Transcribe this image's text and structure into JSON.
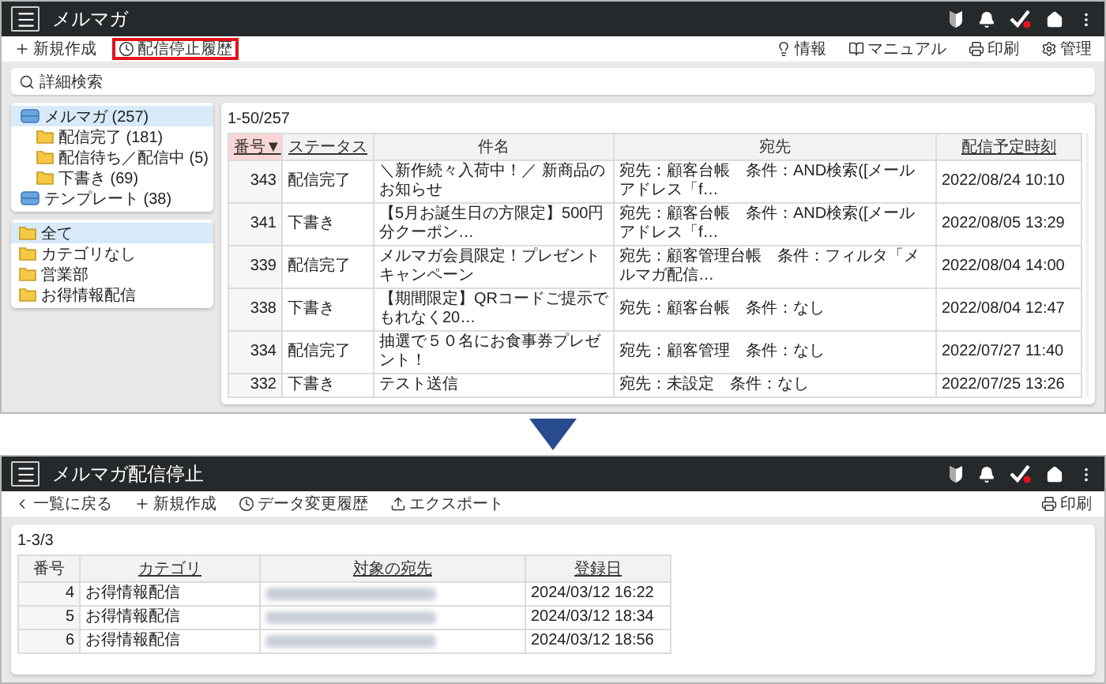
{
  "top_screen": {
    "title": "メルマガ",
    "toolbar_left": [
      {
        "label": "新規作成",
        "highlighted": false
      },
      {
        "label": "配信停止履歴",
        "highlighted": true
      }
    ],
    "toolbar_right": [
      "情報",
      "マニュアル",
      "印刷",
      "管理"
    ],
    "search": {
      "label": "詳細検索"
    },
    "tree": [
      {
        "label": "メルマガ (257)",
        "kind": "tray",
        "selected": true,
        "children": [
          {
            "label": "配信完了 (181)",
            "kind": "folder",
            "selected": false
          },
          {
            "label": "配信待ち／配信中 (5)",
            "kind": "folder",
            "selected": false
          },
          {
            "label": "下書き (69)",
            "kind": "folder",
            "selected": false
          }
        ]
      },
      {
        "label": "テンプレート (38)",
        "kind": "tray",
        "selected": false
      }
    ],
    "categories": [
      {
        "label": "全て",
        "selected": true
      },
      {
        "label": "カテゴリなし",
        "selected": false
      },
      {
        "label": "営業部",
        "selected": false
      },
      {
        "label": "お得情報配信",
        "selected": false
      }
    ],
    "count": "1-50/257",
    "table": {
      "columns": [
        {
          "label": "番号▼",
          "sortable": true,
          "sorted": true
        },
        {
          "label": "ステータス",
          "sortable": true,
          "sorted": false
        },
        {
          "label": "件名",
          "sortable": false,
          "sorted": false
        },
        {
          "label": "宛先",
          "sortable": false,
          "sorted": false
        },
        {
          "label": "配信予定時刻",
          "sortable": true,
          "sorted": false
        }
      ],
      "rows": [
        {
          "number": "343",
          "status": "配信完了",
          "subject": "＼新作続々入荷中！／ 新商品のお知らせ",
          "recipient": "宛先：顧客台帳　条件：AND検索([メールアドレス「f…",
          "scheduled": "2022/08/24 10:10"
        },
        {
          "number": "341",
          "status": "下書き",
          "subject": "【5月お誕生日の方限定】500円分クーポン…",
          "recipient": "宛先：顧客台帳　条件：AND検索([メールアドレス「f…",
          "scheduled": "2022/08/05 13:29"
        },
        {
          "number": "339",
          "status": "配信完了",
          "subject": "メルマガ会員限定！プレゼントキャンペーン",
          "recipient": "宛先：顧客管理台帳　条件：フィルタ「メルマガ配信…",
          "scheduled": "2022/08/04 14:00"
        },
        {
          "number": "338",
          "status": "下書き",
          "subject": "【期間限定】QRコードご提示でもれなく20…",
          "recipient": "宛先：顧客台帳　条件：なし",
          "scheduled": "2022/08/04 12:47"
        },
        {
          "number": "334",
          "status": "配信完了",
          "subject": "抽選で５０名にお食事券プレゼント！",
          "recipient": "宛先：顧客管理　条件：なし",
          "scheduled": "2022/07/27 11:40"
        },
        {
          "number": "332",
          "status": "下書き",
          "subject": "テスト送信",
          "recipient": "宛先：未設定　条件：なし",
          "scheduled": "2022/07/25 13:26"
        }
      ]
    }
  },
  "bottom_screen": {
    "title": "メルマガ配信停止",
    "toolbar_left": [
      "一覧に戻る",
      "新規作成",
      "データ変更履歴",
      "エクスポート"
    ],
    "toolbar_right": [
      "印刷"
    ],
    "count": "1-3/3",
    "table": {
      "columns": [
        {
          "label": "番号",
          "sortable": false
        },
        {
          "label": "カテゴリ",
          "sortable": true
        },
        {
          "label": "対象の宛先",
          "sortable": true
        },
        {
          "label": "登録日",
          "sortable": true
        }
      ],
      "rows": [
        {
          "number": "4",
          "category": "お得情報配信",
          "address_blurred": true,
          "date": "2024/03/12 16:22"
        },
        {
          "number": "5",
          "category": "お得情報配信",
          "address_blurred": true,
          "date": "2024/03/12 18:34"
        },
        {
          "number": "6",
          "category": "お得情報配信",
          "address_blurred": true,
          "date": "2024/03/12 18:56"
        }
      ]
    }
  }
}
